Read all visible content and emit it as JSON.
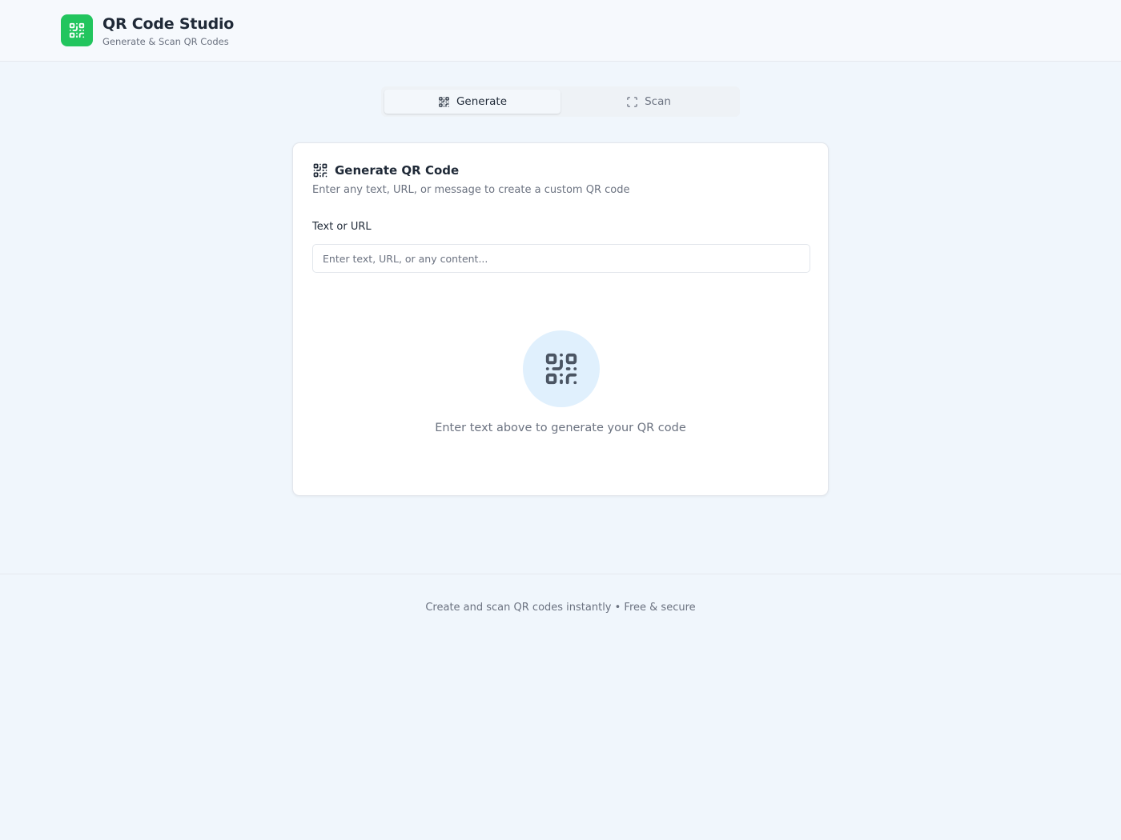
{
  "header": {
    "title": "QR Code Studio",
    "subtitle": "Generate & Scan QR Codes",
    "logo_icon": "qr-code-icon",
    "accent_color": "#22c55e"
  },
  "tabs": [
    {
      "label": "Generate",
      "icon": "qr-code-icon",
      "active": true
    },
    {
      "label": "Scan",
      "icon": "scan-icon",
      "active": false
    }
  ],
  "card": {
    "title": "Generate QR Code",
    "title_icon": "qr-code-icon",
    "description": "Enter any text, URL, or message to create a custom QR code",
    "field_label": "Text or URL",
    "input": {
      "value": "",
      "placeholder": "Enter text, URL, or any content..."
    },
    "empty_state": {
      "icon": "qr-code-icon",
      "text": "Enter text above to generate your QR code"
    }
  },
  "footer": {
    "text": "Create and scan QR codes instantly • Free & secure"
  }
}
